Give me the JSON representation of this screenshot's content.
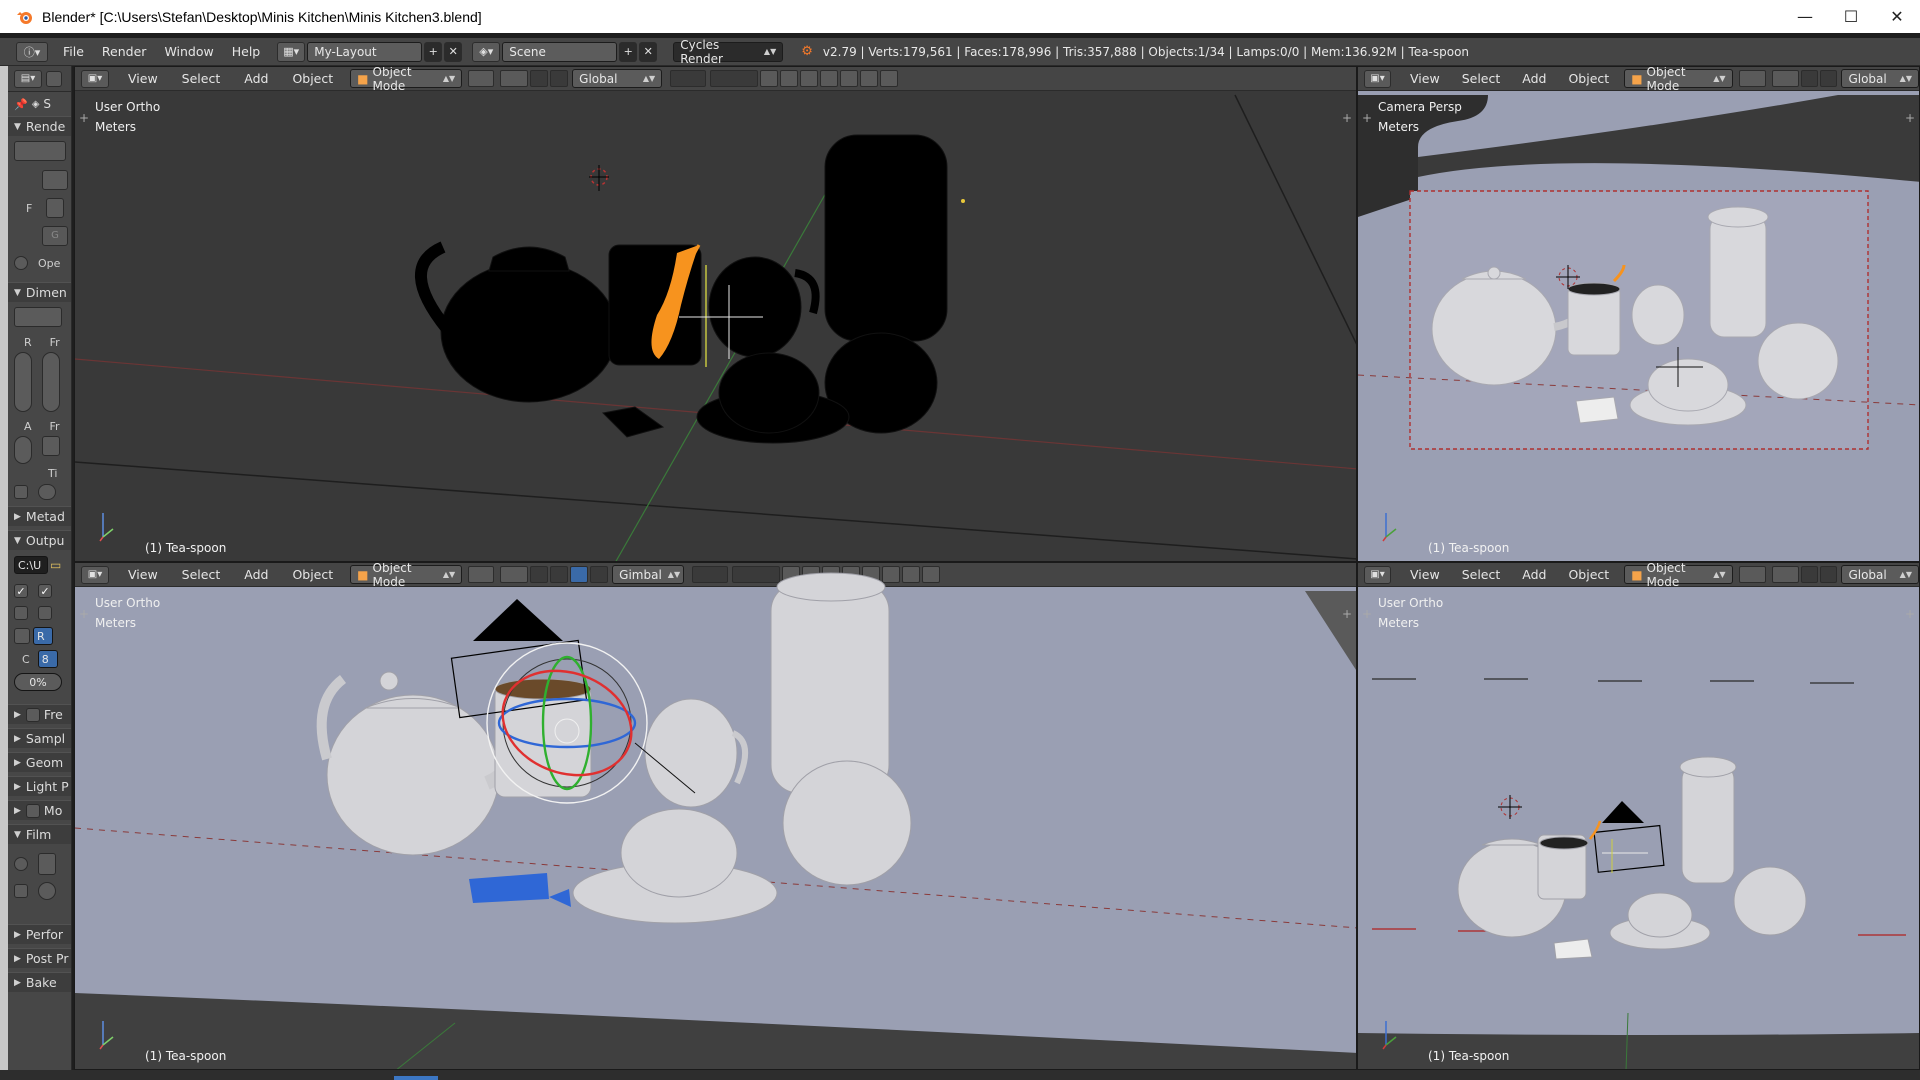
{
  "window": {
    "title": "Blender* [C:\\Users\\Stefan\\Desktop\\Minis Kitchen\\Minis Kitchen3.blend]",
    "minimize": "—",
    "maximize": "☐",
    "close": "✕"
  },
  "info_header": {
    "menus": [
      "File",
      "Render",
      "Window",
      "Help"
    ],
    "screen_layout": "My-Layout",
    "scene": "Scene",
    "render_engine": "Cycles Render",
    "stats": "v2.79 | Verts:179,561 | Faces:178,996 | Tris:357,888 | Objects:1/34 | Lamps:0/0 | Mem:136.92M | Tea-spoon"
  },
  "properties": {
    "tab_label": "S",
    "render_section": "Rende",
    "f_label": "F",
    "g_button": "G",
    "open_label": "Ope",
    "dimensions_section": "Dimen",
    "r_label": "R",
    "fr_label": "Fr",
    "a_label": "A",
    "fr_label_2": "Fr",
    "ti_label": "Ti",
    "metadata_section": "Metad",
    "output_section": "Outpu",
    "output_path": "C:\\U",
    "r_button": "R",
    "c_label": "C",
    "c_value": "8",
    "percent": "0%",
    "freestyle_section": "Fre",
    "sampling_section": "Sampl",
    "geometry_section": "Geom",
    "light_paths_section": "Light P",
    "motion_section": "Mo",
    "film_section": "Film",
    "performance_section": "Perfor",
    "post_processing_section": "Post Pr",
    "bake_section": "Bake"
  },
  "viewports": {
    "top_left": {
      "menus": [
        "View",
        "Select",
        "Add",
        "Object"
      ],
      "mode": "Object Mode",
      "orientation": "Global",
      "view_name": "User Ortho",
      "units": "Meters",
      "object_label": "(1) Tea-spoon"
    },
    "top_right": {
      "menus": [
        "View",
        "Select",
        "Add",
        "Object"
      ],
      "mode": "Object Mode",
      "orientation": "Global",
      "view_name": "Camera Persp",
      "units": "Meters",
      "object_label": "(1) Tea-spoon"
    },
    "bottom_left": {
      "menus": [
        "View",
        "Select",
        "Add",
        "Object"
      ],
      "mode": "Object Mode",
      "orientation": "Gimbal",
      "view_name": "User Ortho",
      "units": "Meters",
      "object_label": "(1) Tea-spoon"
    },
    "bottom_right": {
      "menus": [
        "View",
        "Select",
        "Add",
        "Object"
      ],
      "mode": "Object Mode",
      "orientation": "Global",
      "view_name": "User Ortho",
      "units": "Meters",
      "object_label": "(1) Tea-spoon"
    }
  },
  "colors": {
    "header": "#454545",
    "wireframe_bg": "#393939",
    "solid_bg": "#9a9fb3",
    "selected": "#f7931e"
  }
}
